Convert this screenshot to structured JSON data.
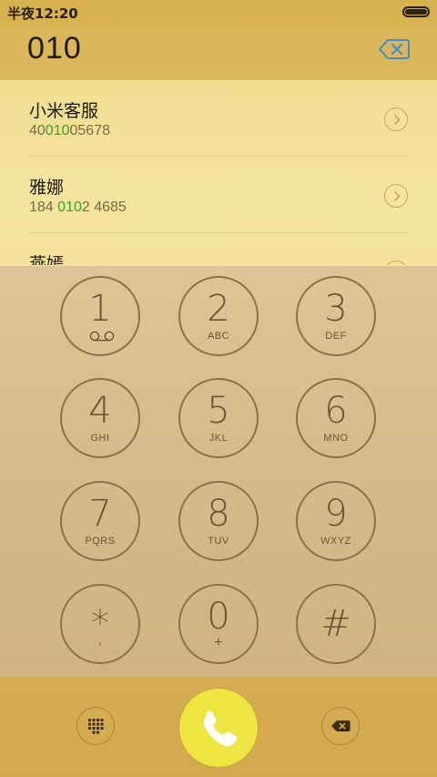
{
  "status_bar": {
    "time": "半夜12:20"
  },
  "header": {
    "typed_number": "010"
  },
  "results": [
    {
      "name": "小米客服",
      "number_pre": "40",
      "number_match": "010",
      "number_post": "05678"
    },
    {
      "name": "雅娜",
      "number_pre": "184 ",
      "number_match": "010",
      "number_post": "2 4685"
    },
    {
      "name": "燕嫣",
      "number_pre": "",
      "number_match": "",
      "number_post": ""
    }
  ],
  "keys": [
    {
      "digit": "1",
      "letters": ""
    },
    {
      "digit": "2",
      "letters": "ABC"
    },
    {
      "digit": "3",
      "letters": "DEF"
    },
    {
      "digit": "4",
      "letters": "GHI"
    },
    {
      "digit": "5",
      "letters": "JKL"
    },
    {
      "digit": "6",
      "letters": "MNO"
    },
    {
      "digit": "7",
      "letters": "PQRS"
    },
    {
      "digit": "8",
      "letters": "TUV"
    },
    {
      "digit": "9",
      "letters": "WXYZ"
    },
    {
      "digit": "*",
      "letters": ","
    },
    {
      "digit": "0",
      "letters": "+"
    },
    {
      "digit": "#",
      "letters": ""
    }
  ],
  "colors": {
    "match_highlight": "#36a22a",
    "call_button": "#efe540",
    "accent_blue": "#3e8fd0"
  },
  "icons": {
    "voicemail": "voicemail-icon",
    "backspace": "backspace-icon",
    "dialpad": "dialpad-icon",
    "phone": "phone-icon"
  }
}
